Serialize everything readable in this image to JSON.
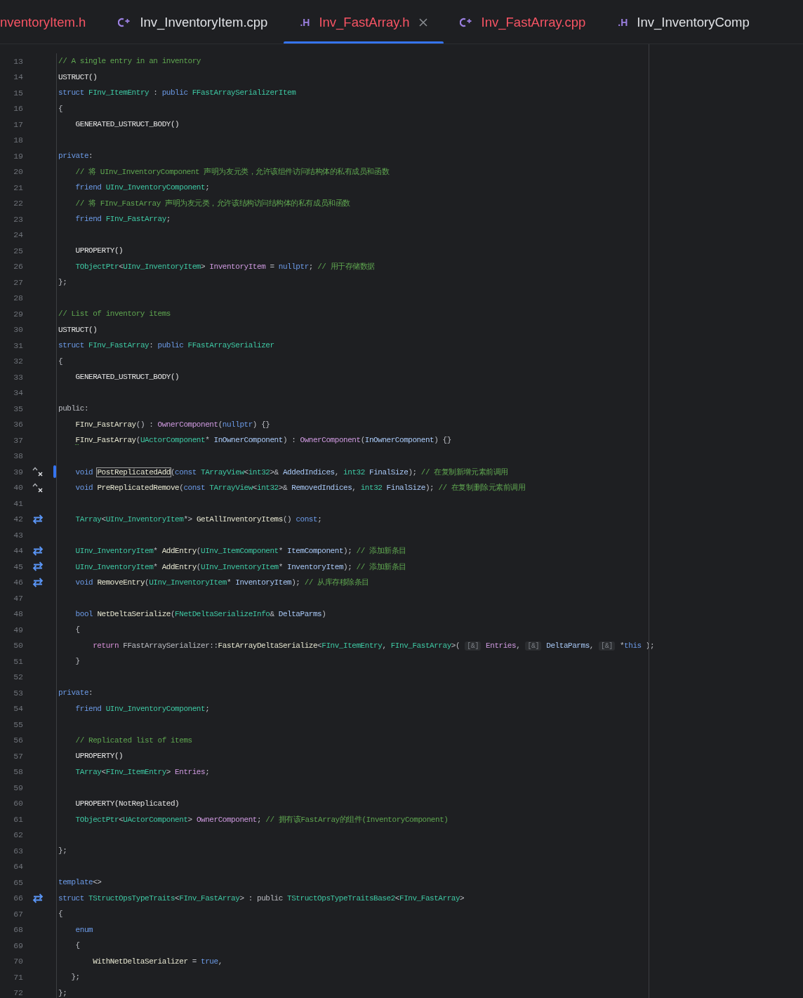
{
  "tabs": [
    {
      "label": "nventoryItem.h",
      "error": true,
      "selected": false
    },
    {
      "kind": "source",
      "label": "Inv_InventoryItem.cpp",
      "error": false,
      "selected": false
    },
    {
      "kind": "header",
      "icon": ".H",
      "label": "Inv_FastArray.h",
      "error": true,
      "selected": true
    },
    {
      "kind": "source",
      "label": "Inv_FastArray.cpp",
      "error": true,
      "selected": false
    },
    {
      "kind": "header",
      "icon": ".H",
      "label": "Inv_InventoryComp",
      "error": false,
      "selected": false
    }
  ],
  "lines": [
    {
      "number": "13",
      "modified": false,
      "tokens": [
        {
          "kind": "comment",
          "text": "// A single entry in an inventory"
        }
      ]
    },
    {
      "number": "14",
      "modified": false,
      "tokens": [
        {
          "kind": "macro",
          "text": "USTRUCT()"
        }
      ]
    },
    {
      "number": "15",
      "modified": false,
      "tokens": [
        {
          "kind": "keyword",
          "text": "struct "
        },
        {
          "kind": "type",
          "text": "FInv_ItemEntry"
        },
        {
          "kind": "plain",
          "text": " : "
        },
        {
          "kind": "keyword",
          "text": "public "
        },
        {
          "kind": "type",
          "text": "FFastArraySerializerItem"
        }
      ]
    },
    {
      "number": "16",
      "modified": false,
      "tokens": [
        {
          "kind": "plain",
          "text": "{"
        }
      ]
    },
    {
      "number": "17",
      "modified": false,
      "tokens": [
        {
          "kind": "macro",
          "text": "    GENERATED_USTRUCT_BODY()"
        }
      ]
    },
    {
      "number": "18",
      "modified": false
    },
    {
      "number": "19",
      "modified": false,
      "tokens": [
        {
          "kind": "keyword",
          "text": "private"
        },
        {
          "kind": "plain",
          "text": ":"
        }
      ]
    },
    {
      "number": "20",
      "modified": false,
      "tokens": [
        {
          "kind": "comment",
          "text": "    // 将 UInv_InventoryComponent 声明为友元类，允许该组件访问结构体的私有成员和函数"
        }
      ]
    },
    {
      "number": "21",
      "modified": false,
      "tokens": [
        {
          "kind": "keyword",
          "text": "    friend "
        },
        {
          "kind": "type",
          "text": "UInv_InventoryComponent"
        },
        {
          "kind": "plain",
          "text": ";"
        }
      ]
    },
    {
      "number": "22",
      "modified": false,
      "tokens": [
        {
          "kind": "comment",
          "text": "    // 将 FInv_FastArray 声明为友元类，允许该结构访问结构体的私有成员和函数"
        }
      ]
    },
    {
      "number": "23",
      "modified": false,
      "tokens": [
        {
          "kind": "keyword",
          "text": "    friend "
        },
        {
          "kind": "type",
          "text": "FInv_FastArray"
        },
        {
          "kind": "plain",
          "text": ";"
        }
      ]
    },
    {
      "number": "24",
      "modified": false
    },
    {
      "number": "25",
      "modified": false,
      "tokens": [
        {
          "kind": "macro",
          "text": "    UPROPERTY()"
        }
      ]
    },
    {
      "number": "26",
      "modified": false,
      "tokens": [
        {
          "kind": "type",
          "text": "    TObjectPtr"
        },
        {
          "kind": "plain",
          "text": "<"
        },
        {
          "kind": "type",
          "text": "UInv_InventoryItem"
        },
        {
          "kind": "plain",
          "text": "> "
        },
        {
          "kind": "field",
          "text": "InventoryItem"
        },
        {
          "kind": "plain",
          "text": " = "
        },
        {
          "kind": "keyword",
          "text": "nullptr"
        },
        {
          "kind": "plain",
          "text": "; "
        },
        {
          "kind": "comment",
          "text": "// 用于存储数据"
        }
      ]
    },
    {
      "number": "27",
      "modified": false,
      "tokens": [
        {
          "kind": "plain",
          "text": "};"
        }
      ]
    },
    {
      "number": "28",
      "modified": false
    },
    {
      "number": "29",
      "modified": false,
      "tokens": [
        {
          "kind": "comment",
          "text": "// List of inventory items"
        }
      ]
    },
    {
      "number": "30",
      "modified": false,
      "tokens": [
        {
          "kind": "macro",
          "text": "USTRUCT()"
        }
      ]
    },
    {
      "number": "31",
      "modified": false,
      "tokens": [
        {
          "kind": "keyword",
          "text": "struct "
        },
        {
          "kind": "type",
          "text": "FInv_FastArray"
        },
        {
          "kind": "plain",
          "text": ": "
        },
        {
          "kind": "keyword",
          "text": "public "
        },
        {
          "kind": "type",
          "text": "FFastArraySerializer"
        }
      ]
    },
    {
      "number": "32",
      "modified": false,
      "tokens": [
        {
          "kind": "plain",
          "text": "{"
        }
      ]
    },
    {
      "number": "33",
      "modified": false,
      "tokens": [
        {
          "kind": "macro",
          "text": "    GENERATED_USTRUCT_BODY()"
        }
      ]
    },
    {
      "number": "34",
      "modified": false
    },
    {
      "number": "35",
      "modified": false,
      "tokens": [
        {
          "kind": "plain",
          "text": "public:"
        }
      ]
    },
    {
      "number": "36",
      "modified": false,
      "tokens": [
        {
          "kind": "function",
          "text": "    FInv_FastArray"
        },
        {
          "kind": "plain",
          "text": "() : "
        },
        {
          "kind": "field",
          "text": "OwnerComponent"
        },
        {
          "kind": "plain",
          "text": "("
        },
        {
          "kind": "keyword",
          "text": "nullptr"
        },
        {
          "kind": "plain",
          "text": ") {}"
        }
      ]
    },
    {
      "number": "37",
      "modified": false,
      "tokens": [
        {
          "kind": "warning",
          "text": "    F"
        },
        {
          "kind": "function",
          "text": "Inv_FastArray"
        },
        {
          "kind": "plain",
          "text": "("
        },
        {
          "kind": "type",
          "text": "UActorComponent"
        },
        {
          "kind": "plain",
          "text": "* "
        },
        {
          "kind": "param",
          "text": "InOwnerComponent"
        },
        {
          "kind": "plain",
          "text": ") : "
        },
        {
          "kind": "field",
          "text": "OwnerComponent"
        },
        {
          "kind": "plain",
          "text": "("
        },
        {
          "kind": "param",
          "text": "InOwnerComponent"
        },
        {
          "kind": "plain",
          "text": ") {}"
        }
      ]
    },
    {
      "number": "38",
      "modified": false
    },
    {
      "number": "39",
      "modified": true,
      "marker": {
        "kind": "override"
      },
      "tokens": [
        {
          "kind": "keyword",
          "text": "    void "
        },
        {
          "kind": "boxed",
          "text": "PostReplicatedAdd"
        },
        {
          "kind": "plain",
          "text": "("
        },
        {
          "kind": "keyword",
          "text": "const "
        },
        {
          "kind": "type",
          "text": "TArrayView"
        },
        {
          "kind": "plain",
          "text": "<"
        },
        {
          "kind": "type",
          "text": "int32"
        },
        {
          "kind": "plain",
          "text": ">& "
        },
        {
          "kind": "param",
          "text": "AddedIndices"
        },
        {
          "kind": "plain",
          "text": ", "
        },
        {
          "kind": "type",
          "text": "int32 "
        },
        {
          "kind": "param",
          "text": "FinalSize"
        },
        {
          "kind": "plain",
          "text": "); "
        },
        {
          "kind": "comment",
          "text": "// 在复制新增元素前调用"
        }
      ]
    },
    {
      "number": "40",
      "modified": false,
      "marker": {
        "kind": "override"
      },
      "tokens": [
        {
          "kind": "keyword",
          "text": "    void "
        },
        {
          "kind": "function",
          "text": "PreReplicatedRemove"
        },
        {
          "kind": "plain",
          "text": "("
        },
        {
          "kind": "keyword",
          "text": "const "
        },
        {
          "kind": "type",
          "text": "TArrayView"
        },
        {
          "kind": "plain",
          "text": "<"
        },
        {
          "kind": "type",
          "text": "int32"
        },
        {
          "kind": "plain",
          "text": ">& "
        },
        {
          "kind": "param",
          "text": "RemovedIndices"
        },
        {
          "kind": "plain",
          "text": ", "
        },
        {
          "kind": "type",
          "text": "int32 "
        },
        {
          "kind": "param",
          "text": "FinalSize"
        },
        {
          "kind": "plain",
          "text": "); "
        },
        {
          "kind": "comment",
          "text": "// 在复制删除元素前调用"
        }
      ]
    },
    {
      "number": "41",
      "modified": false
    },
    {
      "number": "42",
      "modified": false,
      "marker": {
        "kind": "link"
      },
      "tokens": [
        {
          "kind": "type",
          "text": "    TArray"
        },
        {
          "kind": "plain",
          "text": "<"
        },
        {
          "kind": "type",
          "text": "UInv_InventoryItem"
        },
        {
          "kind": "plain",
          "text": "*> "
        },
        {
          "kind": "function",
          "text": "GetAllInventoryItems"
        },
        {
          "kind": "plain",
          "text": "() "
        },
        {
          "kind": "keyword",
          "text": "const"
        },
        {
          "kind": "plain",
          "text": ";"
        }
      ]
    },
    {
      "number": "43",
      "modified": false
    },
    {
      "number": "44",
      "modified": false,
      "marker": {
        "kind": "link"
      },
      "tokens": [
        {
          "kind": "type",
          "text": "    UInv_InventoryItem"
        },
        {
          "kind": "plain",
          "text": "* "
        },
        {
          "kind": "function",
          "text": "AddEntry"
        },
        {
          "kind": "plain",
          "text": "("
        },
        {
          "kind": "type",
          "text": "UInv_ItemComponent"
        },
        {
          "kind": "plain",
          "text": "* "
        },
        {
          "kind": "param",
          "text": "ItemComponent"
        },
        {
          "kind": "plain",
          "text": "); "
        },
        {
          "kind": "comment",
          "text": "// 添加新条目"
        }
      ]
    },
    {
      "number": "45",
      "modified": false,
      "marker": {
        "kind": "link"
      },
      "tokens": [
        {
          "kind": "type",
          "text": "    UInv_InventoryItem"
        },
        {
          "kind": "plain",
          "text": "* "
        },
        {
          "kind": "function",
          "text": "AddEntry"
        },
        {
          "kind": "plain",
          "text": "("
        },
        {
          "kind": "type",
          "text": "UInv_InventoryItem"
        },
        {
          "kind": "plain",
          "text": "* "
        },
        {
          "kind": "param",
          "text": "InventoryItem"
        },
        {
          "kind": "plain",
          "text": "); "
        },
        {
          "kind": "comment",
          "text": "// 添加新条目"
        }
      ]
    },
    {
      "number": "46",
      "modified": false,
      "marker": {
        "kind": "link"
      },
      "tokens": [
        {
          "kind": "keyword",
          "text": "    void "
        },
        {
          "kind": "function",
          "text": "RemoveEntry"
        },
        {
          "kind": "plain",
          "text": "("
        },
        {
          "kind": "type",
          "text": "UInv_InventoryItem"
        },
        {
          "kind": "plain",
          "text": "* "
        },
        {
          "kind": "param",
          "text": "InventoryItem"
        },
        {
          "kind": "plain",
          "text": "); "
        },
        {
          "kind": "comment",
          "text": "// 从库存移除条目"
        }
      ]
    },
    {
      "number": "47",
      "modified": false
    },
    {
      "number": "48",
      "modified": false,
      "tokens": [
        {
          "kind": "keyword",
          "text": "    bool "
        },
        {
          "kind": "function",
          "text": "NetDeltaSerialize"
        },
        {
          "kind": "plain",
          "text": "("
        },
        {
          "kind": "type",
          "text": "FNetDeltaSerializeInfo"
        },
        {
          "kind": "plain",
          "text": "& "
        },
        {
          "kind": "param",
          "text": "DeltaParms"
        },
        {
          "kind": "plain",
          "text": ")"
        }
      ]
    },
    {
      "number": "49",
      "modified": false,
      "tokens": [
        {
          "kind": "plain",
          "text": "    {"
        }
      ]
    },
    {
      "number": "50",
      "modified": false,
      "tokens": [
        {
          "kind": "return",
          "text": "        return"
        },
        {
          "kind": "plain",
          "text": " FFastArraySerializer::"
        },
        {
          "kind": "function",
          "text": "FastArrayDeltaSerialize"
        },
        {
          "kind": "plain",
          "text": "<"
        },
        {
          "kind": "type",
          "text": "FInv_ItemEntry"
        },
        {
          "kind": "plain",
          "text": ", "
        },
        {
          "kind": "type",
          "text": "FInv_FastArray"
        },
        {
          "kind": "plain",
          "text": ">( "
        },
        {
          "kind": "hint",
          "text": "[&]"
        },
        {
          "kind": "field",
          "text": " Entries"
        },
        {
          "kind": "plain",
          "text": ", "
        },
        {
          "kind": "hint",
          "text": "[&]"
        },
        {
          "kind": "param",
          "text": " DeltaParms"
        },
        {
          "kind": "plain",
          "text": ", "
        },
        {
          "kind": "hint",
          "text": "[&]"
        },
        {
          "kind": "plain",
          "text": " *"
        },
        {
          "kind": "keyword",
          "text": "this"
        },
        {
          "kind": "plain",
          "text": " );"
        }
      ]
    },
    {
      "number": "51",
      "modified": false,
      "tokens": [
        {
          "kind": "plain",
          "text": "    }"
        }
      ]
    },
    {
      "number": "52",
      "modified": false
    },
    {
      "number": "53",
      "modified": false,
      "tokens": [
        {
          "kind": "keyword",
          "text": "private"
        },
        {
          "kind": "plain",
          "text": ":"
        }
      ]
    },
    {
      "number": "54",
      "modified": false,
      "tokens": [
        {
          "kind": "keyword",
          "text": "    friend "
        },
        {
          "kind": "type",
          "text": "UInv_InventoryComponent"
        },
        {
          "kind": "plain",
          "text": ";"
        }
      ]
    },
    {
      "number": "55",
      "modified": false
    },
    {
      "number": "56",
      "modified": false,
      "tokens": [
        {
          "kind": "comment",
          "text": "    // Replicated list of items"
        }
      ]
    },
    {
      "number": "57",
      "modified": false,
      "tokens": [
        {
          "kind": "macro",
          "text": "    UPROPERTY()"
        }
      ]
    },
    {
      "number": "58",
      "modified": false,
      "tokens": [
        {
          "kind": "type",
          "text": "    TArray"
        },
        {
          "kind": "plain",
          "text": "<"
        },
        {
          "kind": "type",
          "text": "FInv_ItemEntry"
        },
        {
          "kind": "plain",
          "text": "> "
        },
        {
          "kind": "field",
          "text": "Entries"
        },
        {
          "kind": "plain",
          "text": ";"
        }
      ]
    },
    {
      "number": "59",
      "modified": false
    },
    {
      "number": "60",
      "modified": false,
      "tokens": [
        {
          "kind": "macro",
          "text": "    UPROPERTY(NotReplicated)"
        }
      ]
    },
    {
      "number": "61",
      "modified": false,
      "tokens": [
        {
          "kind": "type",
          "text": "    TObjectPtr"
        },
        {
          "kind": "plain",
          "text": "<"
        },
        {
          "kind": "type",
          "text": "UActorComponent"
        },
        {
          "kind": "plain",
          "text": "> "
        },
        {
          "kind": "field",
          "text": "OwnerComponent"
        },
        {
          "kind": "plain",
          "text": "; "
        },
        {
          "kind": "comment",
          "text": "// 拥有该FastArray的组件(InventoryComponent)"
        }
      ]
    },
    {
      "number": "62",
      "modified": false
    },
    {
      "number": "63",
      "modified": false,
      "tokens": [
        {
          "kind": "plain",
          "text": "};"
        }
      ]
    },
    {
      "number": "64",
      "modified": false
    },
    {
      "number": "65",
      "modified": false,
      "tokens": [
        {
          "kind": "keyword",
          "text": "template"
        },
        {
          "kind": "plain",
          "text": "<>"
        }
      ]
    },
    {
      "number": "66",
      "modified": false,
      "marker": {
        "kind": "link"
      },
      "tokens": [
        {
          "kind": "keyword",
          "text": "struct "
        },
        {
          "kind": "type",
          "text": "TStructOpsTypeTraits"
        },
        {
          "kind": "plain",
          "text": "<"
        },
        {
          "kind": "type",
          "text": "FInv_FastArray"
        },
        {
          "kind": "plain",
          "text": "> : public "
        },
        {
          "kind": "type",
          "text": "TStructOpsTypeTraitsBase2"
        },
        {
          "kind": "plain",
          "text": "<"
        },
        {
          "kind": "type",
          "text": "FInv_FastArray"
        },
        {
          "kind": "plain",
          "text": ">"
        }
      ]
    },
    {
      "number": "67",
      "modified": false,
      "tokens": [
        {
          "kind": "plain",
          "text": "{"
        }
      ]
    },
    {
      "number": "68",
      "modified": false,
      "tokens": [
        {
          "kind": "keyword",
          "text": "    enum"
        }
      ]
    },
    {
      "number": "69",
      "modified": false,
      "tokens": [
        {
          "kind": "plain",
          "text": "    {"
        }
      ]
    },
    {
      "number": "70",
      "modified": false,
      "tokens": [
        {
          "kind": "function",
          "text": "        WithNetDeltaSerializer"
        },
        {
          "kind": "plain",
          "text": " = "
        },
        {
          "kind": "keyword",
          "text": "true"
        },
        {
          "kind": "plain",
          "text": ","
        }
      ]
    },
    {
      "number": "71",
      "modified": false,
      "tokens": [
        {
          "kind": "plain",
          "text": "   };"
        }
      ]
    },
    {
      "number": "72",
      "modified": false,
      "tokens": [
        {
          "kind": "plain",
          "text": "};"
        }
      ]
    }
  ]
}
